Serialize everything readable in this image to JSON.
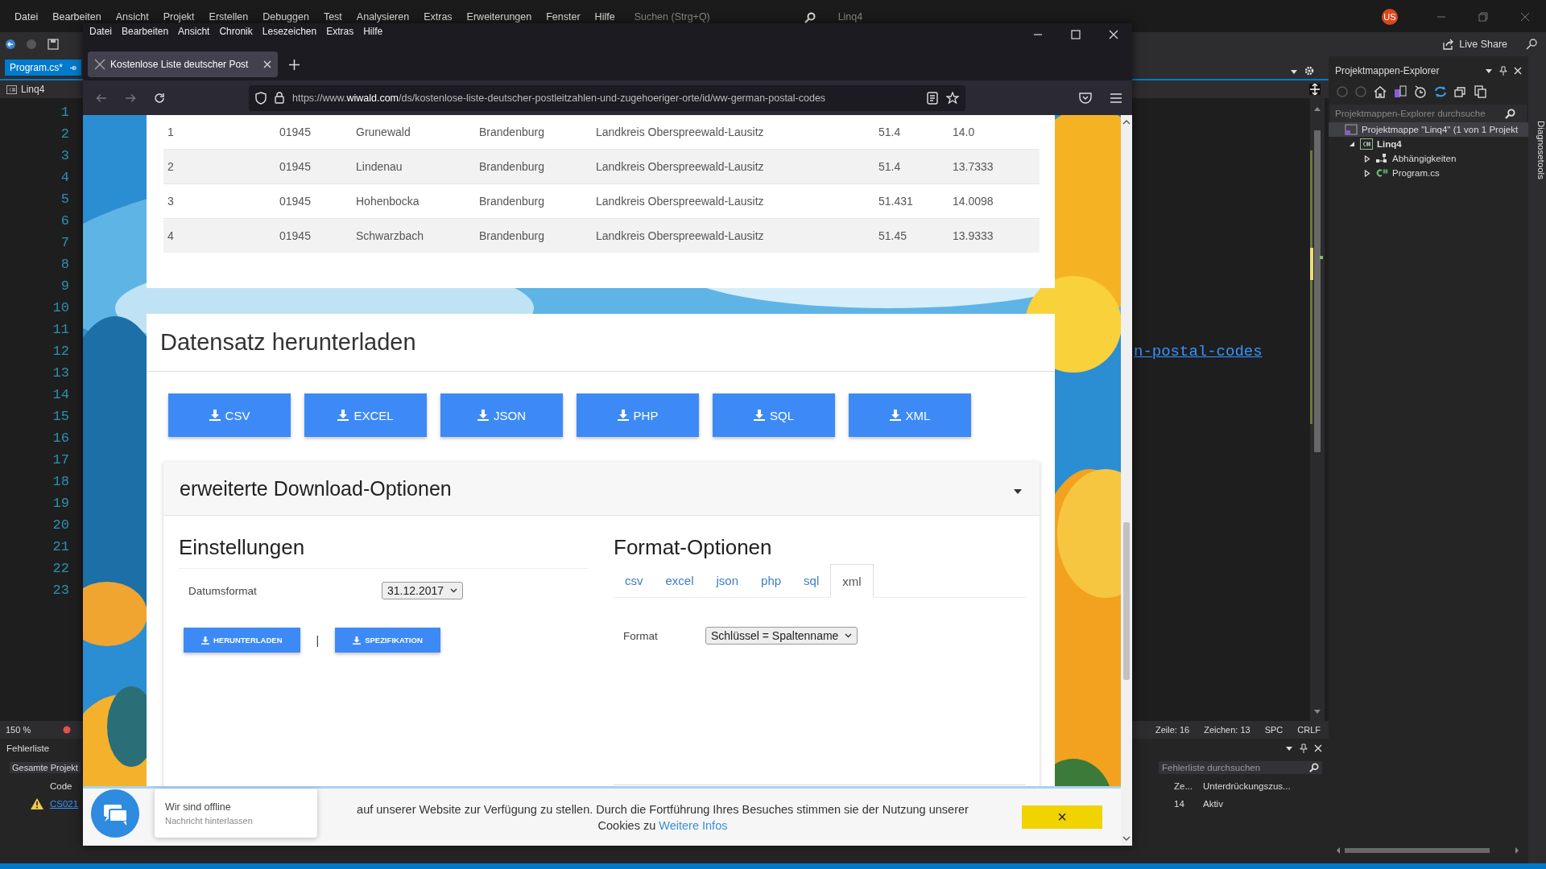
{
  "ide": {
    "menu": [
      "Datei",
      "Bearbeiten",
      "Ansicht",
      "Projekt",
      "Erstellen",
      "Debuggen",
      "Test",
      "Analysieren",
      "Extras",
      "Erweiterungen",
      "Fenster",
      "Hilfe"
    ],
    "search": {
      "placeholder": "Suchen (Strg+Q)"
    },
    "solution_name": "Linq4",
    "avatar": "US",
    "live_share": "Live Share",
    "editor_tab": {
      "label": "Program.cs*",
      "selected": true
    },
    "nav_dropdown": "Linq4",
    "lines": [
      {
        "number": "1"
      },
      {
        "number": "2"
      },
      {
        "number": "3"
      },
      {
        "number": "4"
      },
      {
        "number": "5"
      },
      {
        "number": "6"
      },
      {
        "number": "7"
      },
      {
        "number": "8"
      },
      {
        "number": "9"
      },
      {
        "number": "10"
      },
      {
        "number": "11"
      },
      {
        "number": "12",
        "code": "n-postal-codes"
      },
      {
        "number": "13"
      },
      {
        "number": "14"
      },
      {
        "number": "15"
      },
      {
        "number": "16"
      },
      {
        "number": "17"
      },
      {
        "number": "18"
      },
      {
        "number": "19"
      },
      {
        "number": "20"
      },
      {
        "number": "21"
      },
      {
        "number": "22"
      },
      {
        "number": "23"
      }
    ],
    "zoom": "150 %",
    "status": [
      "Zeile: 16",
      "Zeichen: 13",
      "SPC",
      "CRLF"
    ],
    "error_list": {
      "title": "Fehlerliste",
      "scope": "Gesamte Projekt",
      "search_placeholder": "Fehlerliste durchsuchen",
      "columns": [
        "Code",
        "Ze...",
        "Unterdrückungszus..."
      ],
      "rows": [
        {
          "kind": "warning",
          "code": "CS021",
          "line": "14",
          "suppression": "Aktiv"
        }
      ]
    },
    "solution_explorer": {
      "title": "Projektmappen-Explorer",
      "search_placeholder": "Projektmappen-Explorer durchsuche",
      "tree": [
        {
          "label": "Projektmappe \"Linq4\" (1 von 1 Projekt",
          "kind": "solution",
          "selected": true,
          "children": [
            {
              "label": "Linq4",
              "kind": "project",
              "selected": false,
              "expanded": true,
              "children": [
                {
                  "label": "Abhängigkeiten",
                  "kind": "dependencies",
                  "selected": false,
                  "expanded": false
                },
                {
                  "label": "Program.cs",
                  "kind": "csharp",
                  "selected": false,
                  "expanded": false
                }
              ]
            }
          ]
        }
      ]
    },
    "side_tab": "Diagnosetools"
  },
  "browser": {
    "menu": [
      "Datei",
      "Bearbeiten",
      "Ansicht",
      "Chronik",
      "Lesezeichen",
      "Extras",
      "Hilfe"
    ],
    "tabs": [
      {
        "label": "Kostenlose Liste deutscher Post",
        "selected": true
      }
    ],
    "url": {
      "prefix": "https://www.",
      "domain": "wiwald.com",
      "path": "/ds/kostenlose-liste-deutscher-postleitzahlen-und-zugehoeriger-orte/id/ww-german-postal-codes"
    },
    "table": {
      "rows": [
        [
          "1",
          "01945",
          "Grunewald",
          "Brandenburg",
          "Landkreis Oberspreewald-Lausitz",
          "51.4",
          "14.0"
        ],
        [
          "2",
          "01945",
          "Lindenau",
          "Brandenburg",
          "Landkreis Oberspreewald-Lausitz",
          "51.4",
          "13.7333"
        ],
        [
          "3",
          "01945",
          "Hohenbocka",
          "Brandenburg",
          "Landkreis Oberspreewald-Lausitz",
          "51.431",
          "14.0098"
        ],
        [
          "4",
          "01945",
          "Schwarzbach",
          "Brandenburg",
          "Landkreis Oberspreewald-Lausitz",
          "51.45",
          "13.9333"
        ]
      ]
    },
    "download": {
      "title": "Datensatz herunterladen",
      "buttons": [
        "CSV",
        "EXCEL",
        "JSON",
        "PHP",
        "SQL",
        "XML"
      ]
    },
    "advanced": {
      "title": "erweiterte Download-Optionen",
      "expanded": true,
      "settings": {
        "title": "Einstellungen",
        "date_label": "Datumsformat",
        "date_value": "31.12.2017",
        "buttons": [
          "HERUNTERLADEN",
          "SPEZIFIKATION"
        ],
        "separator": "|"
      },
      "format": {
        "title": "Format-Optionen",
        "tabs": [
          {
            "label": "csv",
            "selected": false
          },
          {
            "label": "excel",
            "selected": false
          },
          {
            "label": "json",
            "selected": false
          },
          {
            "label": "php",
            "selected": false
          },
          {
            "label": "sql",
            "selected": false
          },
          {
            "label": "xml",
            "selected": true
          }
        ],
        "format_label": "Format",
        "format_value": "Schlüssel = Spaltenname"
      }
    },
    "cookie": {
      "text": "auf unserer Website zur Verfügung zu stellen. Durch die Fortführung Ihres Besuches stimmen sie der Nutzung unserer",
      "text2": "Cookies zu",
      "link": "Weitere Infos",
      "close": "×"
    },
    "chat": {
      "title": "Wir sind offline",
      "subtitle": "Nachricht hinterlassen"
    }
  }
}
